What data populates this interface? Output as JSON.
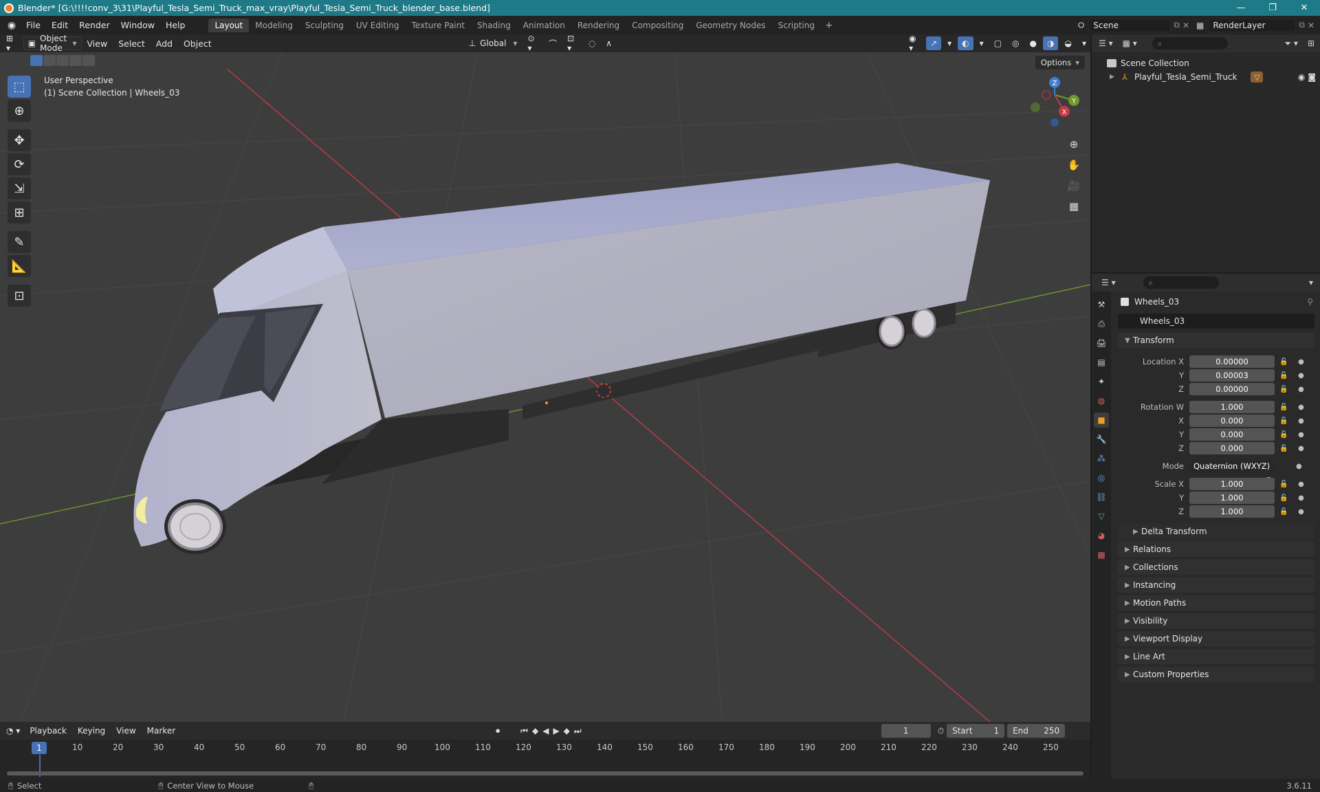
{
  "titlebar": {
    "title": "Blender* [G:\\!!!!conv_3\\31\\Playful_Tesla_Semi_Truck_max_vray\\Playful_Tesla_Semi_Truck_blender_base.blend]",
    "controls": [
      "—",
      "❐",
      "✕"
    ]
  },
  "menubar": {
    "items": [
      "File",
      "Edit",
      "Render",
      "Window",
      "Help"
    ],
    "workspaces": [
      "Layout",
      "Modeling",
      "Sculpting",
      "UV Editing",
      "Texture Paint",
      "Shading",
      "Animation",
      "Rendering",
      "Compositing",
      "Geometry Nodes",
      "Scripting"
    ],
    "active_workspace": "Layout",
    "scene": "Scene",
    "render_layer": "RenderLayer"
  },
  "viewport": {
    "mode": "Object Mode",
    "menus": [
      "View",
      "Select",
      "Add",
      "Object"
    ],
    "orientation": "Global",
    "options_label": "Options",
    "info_line1": "User Perspective",
    "info_line2": "(1) Scene Collection | Wheels_03",
    "gizmo_axes": {
      "z": "Z",
      "y": "Y",
      "x": "X"
    },
    "colors": {
      "background": "#3d3d3d",
      "x_axis": "#c33a47",
      "y_axis": "#6e9a2c",
      "truck_body": "#b4b6cc"
    }
  },
  "outliner": {
    "root": "Scene Collection",
    "object": "Playful_Tesla_Semi_Truck"
  },
  "properties": {
    "object_name": "Wheels_03",
    "object_field": "Wheels_03",
    "transform_title": "Transform",
    "location": {
      "label": "Location X",
      "x": "0.00000",
      "y": "0.00003",
      "z": "0.00000"
    },
    "rotation": {
      "label": "Rotation W",
      "w": "1.000",
      "x": "0.000",
      "y": "0.000",
      "z": "0.000"
    },
    "mode_label": "Mode",
    "mode_value": "Quaternion (WXYZ)",
    "scale": {
      "label": "Scale X",
      "x": "1.000",
      "y": "1.000",
      "z": "1.000"
    },
    "axis_labels": {
      "y": "Y",
      "z": "Z",
      "x": "X"
    },
    "delta_transform": "Delta Transform",
    "panels": [
      "Relations",
      "Collections",
      "Instancing",
      "Motion Paths",
      "Visibility",
      "Viewport Display",
      "Line Art",
      "Custom Properties"
    ]
  },
  "timeline": {
    "menus": [
      "Playback",
      "Keying",
      "View",
      "Marker"
    ],
    "current_frame": "1",
    "start_label": "Start",
    "start_value": "1",
    "end_label": "End",
    "end_value": "250",
    "ruler": [
      "10",
      "20",
      "30",
      "40",
      "50",
      "60",
      "70",
      "80",
      "90",
      "100",
      "110",
      "120",
      "130",
      "140",
      "150",
      "160",
      "170",
      "180",
      "190",
      "200",
      "210",
      "220",
      "230",
      "240",
      "250"
    ]
  },
  "statusbar": {
    "select": "Select",
    "center_view": "Center View to Mouse",
    "version": "3.6.11"
  }
}
